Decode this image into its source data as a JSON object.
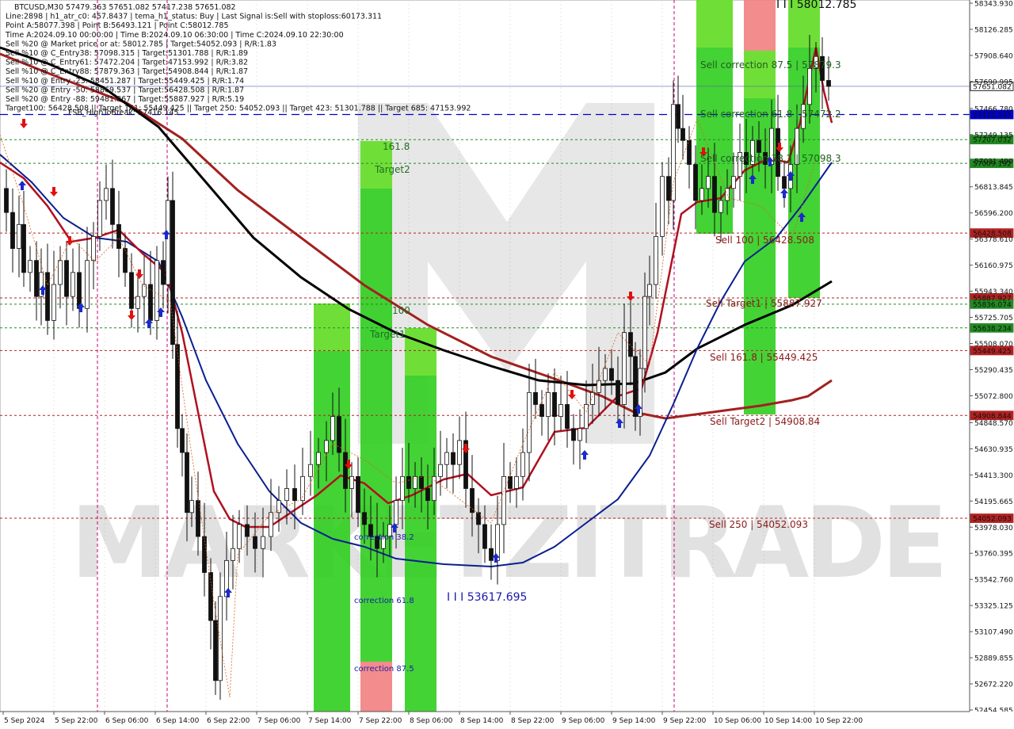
{
  "header": {
    "lines": [
      "BTCUSD,M30  57479.363 57651.082 57417.238 57651.082",
      "Line:2898 | h1_atr_c0: 457.8437 | tema_h1_status: Buy | Last Signal is:Sell with stoploss:60173.311",
      "Point A:58077.398 | Point B:56493.121 | Point C:58012.785",
      "Time A:2024.09.10 00:00:00 | Time B:2024.09.10 06:30:00 | Time C:2024.09.10 22:30:00",
      "Sell %20 @ Market price or at: 58012.785 | Target:54052.093 | R/R:1.83",
      "Sell %10 @ C_Entry38: 57098.315 | Target:51301.788 | R/R:1.89",
      "Sell %10 @ C_Entry61: 57472.204 | Target:47153.992 | R/R:3.82",
      "Sell %10 @ C_Entry88: 57879.363 | Target:54908.844 | R/R:1.87",
      "Sell %10 @ Entry -23: 58451.287 | Target:55449.425 | R/R:1.74",
      "Sell %20 @ Entry -50: 58869.537 | Target:56428.508 | R/R:1.87",
      "Sell %20 @ Entry -88: 59481.867 | Target:55887.927 | R/R:5.19",
      "Target100: 56428.508 || Target 161: 55449.425 || Target 250: 54052.093 || Target 423: 51301.788 || Target 685: 47153.992"
    ],
    "overlay": "FSB_HighToBreak: 57416.145"
  },
  "price_axis": {
    "ticks": [
      "58343.930",
      "58126.285",
      "57908.640",
      "57690.995",
      "57466.780",
      "57249.135",
      "57031.490",
      "56813.845",
      "56596.200",
      "56378.610",
      "56160.975",
      "55943.340",
      "55725.705",
      "55508.070",
      "55290.435",
      "55072.800",
      "54848.570",
      "54630.935",
      "54413.300",
      "54195.665",
      "53978.030",
      "53760.395",
      "53542.760",
      "53325.125",
      "53107.490",
      "52889.855",
      "52672.220",
      "52454.585"
    ],
    "badges": [
      {
        "value": "57651.082",
        "bg": "#ffffff",
        "fg": "#000000",
        "border": "#000000"
      },
      {
        "value": "57416.145",
        "bg": "#0000cc",
        "fg": "#ffffff"
      },
      {
        "value": "57207.032",
        "bg": "#228b22",
        "fg": "#ffffff"
      },
      {
        "value": "57009.192",
        "bg": "#228b22",
        "fg": "#ffffff"
      },
      {
        "value": "56428.508",
        "bg": "#b22222",
        "fg": "#ffffff"
      },
      {
        "value": "55887.927",
        "bg": "#b22222",
        "fg": "#ffffff"
      },
      {
        "value": "55836.074",
        "bg": "#228b22",
        "fg": "#ffffff"
      },
      {
        "value": "55638.234",
        "bg": "#228b22",
        "fg": "#ffffff"
      },
      {
        "value": "55449.425",
        "bg": "#b22222",
        "fg": "#ffffff"
      },
      {
        "value": "54908.844",
        "bg": "#b22222",
        "fg": "#ffffff"
      },
      {
        "value": "54052.093",
        "bg": "#b22222",
        "fg": "#ffffff"
      }
    ]
  },
  "time_axis": {
    "labels": [
      "5 Sep 2024",
      "5 Sep 22:00",
      "6 Sep 06:00",
      "6 Sep 14:00",
      "6 Sep 22:00",
      "7 Sep 06:00",
      "7 Sep 14:00",
      "7 Sep 22:00",
      "8 Sep 06:00",
      "8 Sep 14:00",
      "8 Sep 22:00",
      "9 Sep 06:00",
      "9 Sep 14:00",
      "9 Sep 22:00",
      "10 Sep 06:00",
      "10 Sep 14:00",
      "10 Sep 22:00"
    ]
  },
  "annotations": [
    {
      "text": "Sell correction 87.5 | 57879.3",
      "price": 57879.3,
      "color": "#1f5f1f"
    },
    {
      "text": "Sell correction 61.8 | 57472.2",
      "price": 57472.2,
      "color": "#1f5f1f"
    },
    {
      "text": "Sell correction 38.2 | 57098.3",
      "price": 57098.3,
      "color": "#1f5f1f"
    },
    {
      "text": "Sell 100 | 56428.508",
      "price": 56428.508,
      "color": "#8b1a1a"
    },
    {
      "text": "Sell Target1 | 55887.927",
      "price": 55887.927,
      "color": "#8b1a1a"
    },
    {
      "text": "Sell 161.8 | 55449.425",
      "price": 55449.425,
      "color": "#8b1a1a"
    },
    {
      "text": "Sell Target2 | 54908.84",
      "price": 54908.84,
      "color": "#8b1a1a"
    },
    {
      "text": "Sell  250 | 54052.093",
      "price": 54052.093,
      "color": "#8b1a1a"
    },
    {
      "text": "I I I 58012.785",
      "price": 58300,
      "color": "#111111"
    },
    {
      "text": "I I I 53617.695",
      "price": 53580,
      "color": "#1a1aaa"
    },
    {
      "text": "161.8",
      "price": 57250,
      "color": "#1f6f1f"
    },
    {
      "text": "Target2",
      "price": 56980,
      "color": "#1f6f1f"
    },
    {
      "text": "100",
      "price": 55740,
      "color": "#1f6f1f"
    },
    {
      "text": "Target1",
      "price": 55480,
      "color": "#1f6f1f"
    },
    {
      "text": "correction 38.2",
      "price": 53830,
      "color": "#1a1aaa"
    },
    {
      "text": "correction 61.8",
      "price": 53250,
      "color": "#1a1aaa"
    },
    {
      "text": "correction 87.5",
      "price": 52820,
      "color": "#1a1aaa"
    }
  ],
  "watermark": "MARKETZITRADE",
  "colors": {
    "candle": "#111111",
    "ma_red": "#b01020",
    "ma_darkred": "#a32020",
    "ma_black": "#000000",
    "ma_blue": "#0a1f8f",
    "zone_green": "#2fce1f",
    "zone_light": "#7be23a",
    "zone_pink": "#f27f7f",
    "grid": "#d8d8d8",
    "vline": "#cc0077"
  },
  "chart_data": {
    "type": "candlestick",
    "symbol": "BTCUSD",
    "timeframe": "M30",
    "ylim": [
      52454.585,
      58343.93
    ],
    "x_labels": [
      "5 Sep 2024",
      "5 Sep 22:00",
      "6 Sep 06:00",
      "6 Sep 14:00",
      "6 Sep 22:00",
      "7 Sep 06:00",
      "7 Sep 14:00",
      "7 Sep 22:00",
      "8 Sep 06:00",
      "8 Sep 14:00",
      "8 Sep 22:00",
      "9 Sep 06:00",
      "9 Sep 14:00",
      "9 Sep 22:00",
      "10 Sep 06:00",
      "10 Sep 14:00",
      "10 Sep 22:00"
    ],
    "levels": [
      {
        "name": "Sell 100",
        "value": 56428.508
      },
      {
        "name": "Sell Target1",
        "value": 55887.927
      },
      {
        "name": "Sell 161.8",
        "value": 55449.425
      },
      {
        "name": "Sell Target2",
        "value": 54908.844
      },
      {
        "name": "Sell 250",
        "value": 54052.093
      },
      {
        "name": "FSB_HighToBreak",
        "value": 57416.145
      },
      {
        "value": 57207.032
      },
      {
        "value": 57009.192
      },
      {
        "value": 55836.074
      },
      {
        "value": 55638.234
      }
    ],
    "close_path": [
      [
        0,
        56800
      ],
      [
        8,
        56600
      ],
      [
        16,
        56300
      ],
      [
        24,
        56500
      ],
      [
        30,
        56100
      ],
      [
        38,
        56200
      ],
      [
        46,
        55900
      ],
      [
        52,
        56100
      ],
      [
        60,
        55700
      ],
      [
        68,
        56000
      ],
      [
        76,
        56200
      ],
      [
        84,
        55900
      ],
      [
        92,
        56100
      ],
      [
        100,
        55800
      ],
      [
        110,
        56200
      ],
      [
        118,
        56400
      ],
      [
        126,
        56700
      ],
      [
        134,
        56800
      ],
      [
        142,
        56500
      ],
      [
        150,
        56300
      ],
      [
        158,
        56100
      ],
      [
        166,
        55800
      ],
      [
        174,
        55900
      ],
      [
        182,
        56000
      ],
      [
        190,
        55700
      ],
      [
        198,
        56200
      ],
      [
        206,
        56000
      ],
      [
        212,
        56700
      ],
      [
        218,
        55500
      ],
      [
        224,
        54800
      ],
      [
        230,
        54600
      ],
      [
        236,
        54100
      ],
      [
        242,
        54200
      ],
      [
        250,
        53900
      ],
      [
        258,
        53600
      ],
      [
        266,
        53200
      ],
      [
        272,
        52700
      ],
      [
        278,
        53400
      ],
      [
        286,
        53700
      ],
      [
        294,
        53800
      ],
      [
        302,
        54000
      ],
      [
        312,
        53900
      ],
      [
        322,
        53800
      ],
      [
        332,
        53900
      ],
      [
        342,
        54100
      ],
      [
        352,
        54200
      ],
      [
        362,
        54300
      ],
      [
        372,
        54200
      ],
      [
        382,
        54400
      ],
      [
        392,
        54500
      ],
      [
        402,
        54600
      ],
      [
        412,
        54700
      ],
      [
        420,
        54900
      ],
      [
        428,
        54600
      ],
      [
        436,
        54300
      ],
      [
        444,
        54400
      ],
      [
        452,
        54100
      ],
      [
        460,
        54000
      ],
      [
        468,
        53900
      ],
      [
        476,
        53800
      ],
      [
        484,
        53900
      ],
      [
        492,
        54000
      ],
      [
        500,
        54200
      ],
      [
        508,
        54400
      ],
      [
        516,
        54300
      ],
      [
        524,
        54400
      ],
      [
        532,
        54300
      ],
      [
        540,
        54200
      ],
      [
        548,
        54400
      ],
      [
        556,
        54500
      ],
      [
        564,
        54600
      ],
      [
        572,
        54500
      ],
      [
        580,
        54700
      ],
      [
        588,
        54300
      ],
      [
        596,
        54100
      ],
      [
        604,
        54000
      ],
      [
        612,
        53800
      ],
      [
        620,
        53700
      ],
      [
        628,
        54000
      ],
      [
        636,
        54400
      ],
      [
        644,
        54300
      ],
      [
        652,
        54400
      ],
      [
        660,
        54600
      ],
      [
        668,
        55100
      ],
      [
        676,
        55000
      ],
      [
        684,
        54900
      ],
      [
        692,
        55100
      ],
      [
        700,
        54900
      ],
      [
        708,
        55000
      ],
      [
        716,
        54800
      ],
      [
        724,
        54700
      ],
      [
        732,
        54800
      ],
      [
        740,
        55000
      ],
      [
        748,
        55100
      ],
      [
        756,
        55200
      ],
      [
        764,
        55300
      ],
      [
        772,
        55200
      ],
      [
        780,
        55000
      ],
      [
        788,
        55600
      ],
      [
        796,
        55400
      ],
      [
        802,
        54900
      ],
      [
        808,
        55300
      ],
      [
        814,
        55900
      ],
      [
        820,
        56000
      ],
      [
        828,
        56400
      ],
      [
        836,
        56900
      ],
      [
        844,
        56700
      ],
      [
        850,
        57500
      ],
      [
        856,
        57300
      ],
      [
        862,
        57200
      ],
      [
        870,
        57000
      ],
      [
        878,
        56700
      ],
      [
        886,
        56800
      ],
      [
        894,
        56900
      ],
      [
        902,
        56600
      ],
      [
        910,
        56700
      ],
      [
        918,
        56800
      ],
      [
        926,
        56900
      ],
      [
        934,
        57100
      ],
      [
        942,
        57000
      ],
      [
        950,
        57200
      ],
      [
        958,
        57100
      ],
      [
        966,
        57000
      ],
      [
        974,
        57300
      ],
      [
        982,
        56900
      ],
      [
        990,
        56800
      ],
      [
        998,
        57000
      ],
      [
        1006,
        57300
      ],
      [
        1014,
        57500
      ],
      [
        1022,
        57800
      ],
      [
        1030,
        57900
      ],
      [
        1038,
        57700
      ],
      [
        1046,
        57651
      ]
    ]
  }
}
